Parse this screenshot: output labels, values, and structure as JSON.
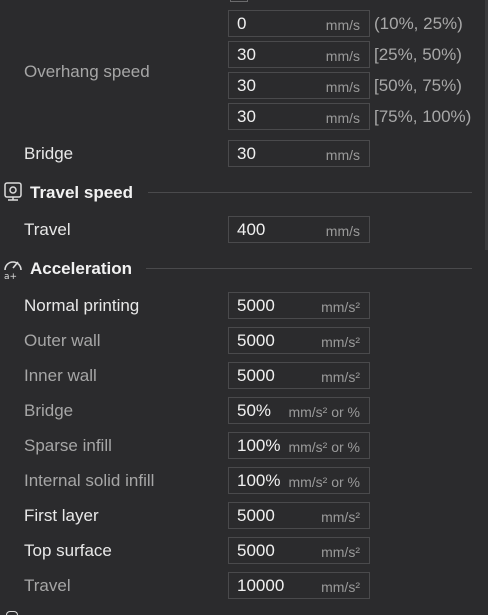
{
  "overhang": {
    "label": "Overhang speed",
    "rows": [
      {
        "value": "0",
        "unit": "mm/s",
        "range": "(10%, 25%)"
      },
      {
        "value": "30",
        "unit": "mm/s",
        "range": "[25%, 50%)"
      },
      {
        "value": "30",
        "unit": "mm/s",
        "range": "[50%, 75%)"
      },
      {
        "value": "30",
        "unit": "mm/s",
        "range": "[75%, 100%)"
      }
    ]
  },
  "bridge": {
    "label": "Bridge",
    "value": "30",
    "unit": "mm/s"
  },
  "travel_speed": {
    "title": "Travel speed",
    "icon": "travel-speed-icon",
    "travel": {
      "label": "Travel",
      "value": "400",
      "unit": "mm/s"
    }
  },
  "acceleration": {
    "title": "Acceleration",
    "icon": "acceleration-icon",
    "rows": [
      {
        "label": "Normal printing",
        "value": "5000",
        "unit": "mm/s²"
      },
      {
        "label": "Outer wall",
        "value": "5000",
        "unit": "mm/s²"
      },
      {
        "label": "Inner wall",
        "value": "5000",
        "unit": "mm/s²"
      },
      {
        "label": "Bridge",
        "value": "50%",
        "unit": "mm/s² or %"
      },
      {
        "label": "Sparse infill",
        "value": "100%",
        "unit": "mm/s² or %"
      },
      {
        "label": "Internal solid infill",
        "value": "100%",
        "unit": "mm/s² or %"
      },
      {
        "label": "First layer",
        "value": "5000",
        "unit": "mm/s²"
      },
      {
        "label": "Top surface",
        "value": "5000",
        "unit": "mm/s²"
      },
      {
        "label": "Travel",
        "value": "10000",
        "unit": "mm/s²"
      }
    ]
  },
  "colors": {
    "background": "#2b2b2d",
    "field_border": "#4a4a4c",
    "text": "#dcdcdc",
    "dim_text": "#a6a6a6"
  }
}
